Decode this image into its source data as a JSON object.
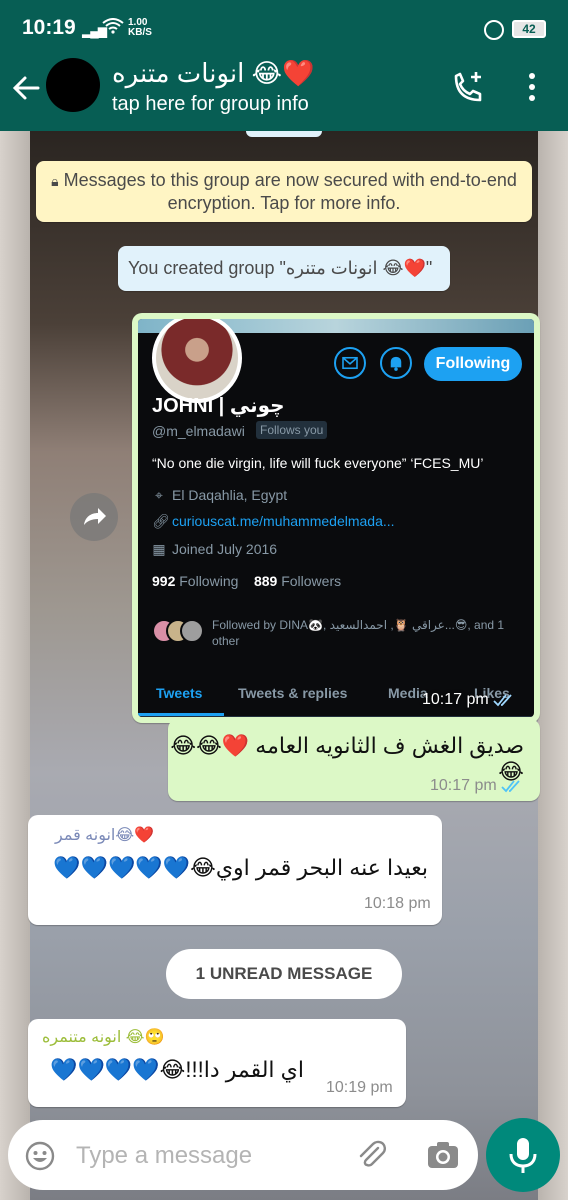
{
  "status_bar": {
    "time": "10:19",
    "network_speed_value": "1.00",
    "network_speed_unit": "KB/S",
    "battery": "42"
  },
  "header": {
    "group_name": "انونات متنره 😂❤️",
    "subtitle": "tap here for group info"
  },
  "system_messages": {
    "encryption": "Messages to this group are now secured with end-to-end encryption. Tap for more info.",
    "created": "You created group \"انونات متنره 😂❤️\""
  },
  "image_message": {
    "time": "10:17 pm",
    "profile": {
      "name": "JOHNI | چوني",
      "handle": "@m_elmadawi",
      "follows_you": "Follows you",
      "bio": "“No one die virgin, life will fuck everyone” ‘FCES_MU’",
      "location": "El Daqahlia, Egypt",
      "link": "curiouscat.me/muhammedelmada...",
      "joined": "Joined July 2016",
      "following_count": "992",
      "following_label": "Following",
      "followers_count": "889",
      "followers_label": "Followers",
      "followed_by": "Followed by DINA🐼, عراقي 🦉, احمدالسعيد...😎, and 1 other",
      "follow_button": "Following",
      "tabs": [
        "Tweets",
        "Tweets & replies",
        "Media",
        "Likes"
      ]
    }
  },
  "messages": [
    {
      "text": "صديق الغش ف الثانويه العامه ❤️😂😂😂",
      "time": "10:17 pm"
    },
    {
      "sender": "انونه قمر😂❤️",
      "text": "بعيدا عنه البحر قمر اوي😂💙💙💙💙💙",
      "time": "10:18 pm"
    },
    {
      "sender": "انونه متنمره 😂🙄",
      "text": "اي القمر دا!!!😂💙💙💙💙",
      "time": "10:19 pm"
    }
  ],
  "unread_label": "1 UNREAD MESSAGE",
  "input": {
    "placeholder": "Type a message"
  },
  "colors": {
    "header": "#075e54",
    "outgoing_bubble": "#dcf8c6",
    "incoming_bubble": "#ffffff",
    "system_yellow": "#fff5c4",
    "system_blue": "#e1f2fb",
    "mic_button": "#00897b",
    "sender1": "#7b8ab8",
    "sender2": "#9cbd3a",
    "twitter_blue": "#1da1f2"
  }
}
